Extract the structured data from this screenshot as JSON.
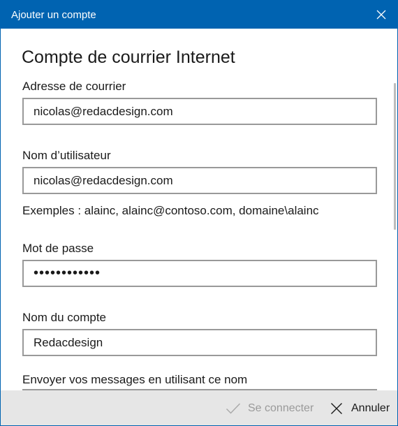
{
  "window": {
    "title": "Ajouter un compte"
  },
  "main": {
    "heading": "Compte de courrier Internet",
    "email": {
      "label": "Adresse de courrier",
      "value": "nicolas@redacdesign.com"
    },
    "username": {
      "label": "Nom d’utilisateur",
      "value": "nicolas@redacdesign.com",
      "hint": "Exemples : alainc, alainc@contoso.com, domaine\\alainc"
    },
    "password": {
      "label": "Mot de passe",
      "value": "secretpasswd"
    },
    "account_name": {
      "label": "Nom du compte",
      "value": "Redacdesign"
    },
    "send_as": {
      "label": "Envoyer vos messages en utilisant ce nom"
    }
  },
  "footer": {
    "connect_label": "Se connecter",
    "cancel_label": "Annuler"
  },
  "icons": {
    "close": "close-icon",
    "check": "checkmark-icon",
    "cancel": "cancel-icon"
  },
  "colors": {
    "titlebar": "#0063b1",
    "footer": "#e6e6e6",
    "field_border": "#999999",
    "disabled_text": "#9a9a9a"
  }
}
